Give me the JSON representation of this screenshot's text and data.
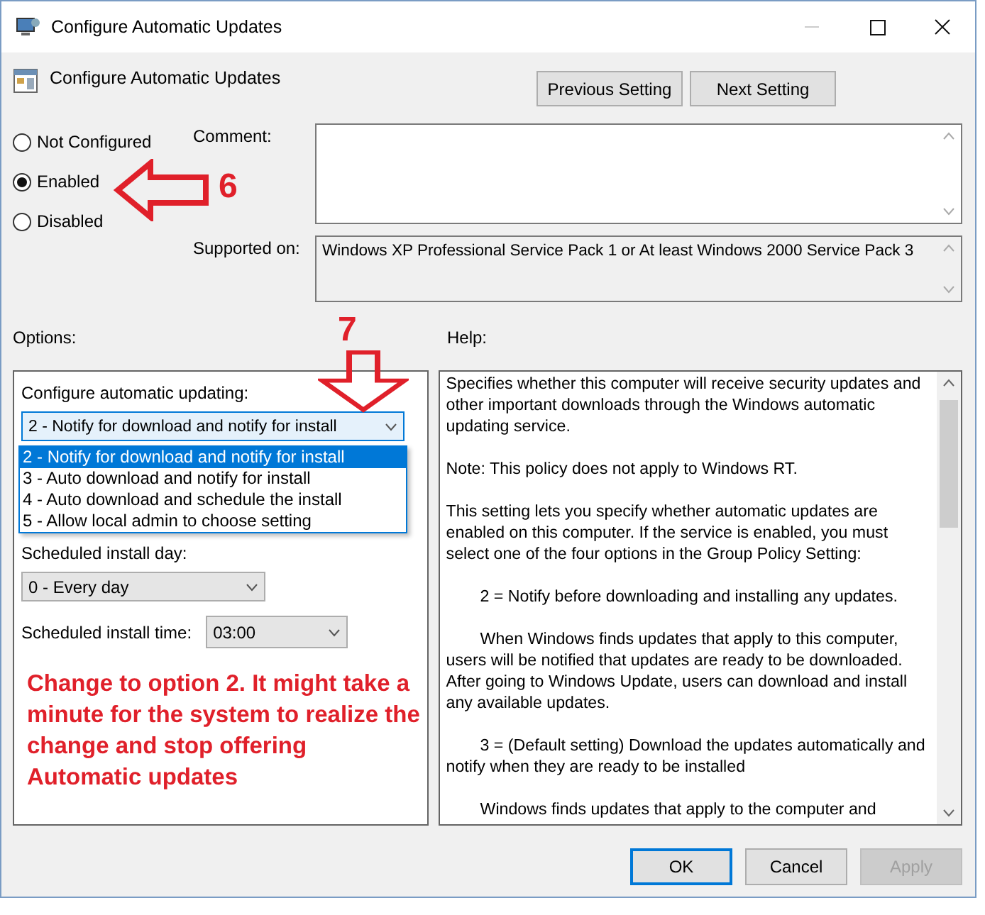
{
  "window": {
    "title": "Configure Automatic Updates"
  },
  "header": {
    "title": "Configure Automatic Updates"
  },
  "nav_buttons": [
    "Previous Setting",
    "Next Setting"
  ],
  "state_options": [
    {
      "label": "Not Configured",
      "selected": false
    },
    {
      "label": "Enabled",
      "selected": true
    },
    {
      "label": "Disabled",
      "selected": false
    }
  ],
  "comment": {
    "label": "Comment:"
  },
  "supported_on": {
    "label": "Supported on:",
    "value": "Windows XP Professional Service Pack 1 or At least Windows 2000 Service Pack 3"
  },
  "options": {
    "label": "Options:",
    "configure_label": "Configure automatic updating:",
    "configure_value": "2 - Notify for download and notify for install",
    "dropdown_items": [
      {
        "label": "2 - Notify for download and notify for install",
        "selected": true
      },
      {
        "label": "3 - Auto download and notify for install",
        "selected": false
      },
      {
        "label": "4 - Auto download and schedule the install",
        "selected": false
      },
      {
        "label": "5 - Allow local admin to choose setting",
        "selected": false
      }
    ],
    "install_day_label": "Scheduled install day:",
    "install_day_value": "0 - Every day",
    "install_time_label": "Scheduled install time:",
    "install_time_value": "03:00"
  },
  "help": {
    "label": "Help:",
    "paragraphs": [
      {
        "kind": "plain",
        "text": "Specifies whether this computer will receive security updates and other important downloads through the Windows automatic updating service."
      },
      {
        "kind": "plain",
        "text": "Note: This policy does not apply to Windows RT."
      },
      {
        "kind": "plain",
        "text": "This setting lets you specify whether automatic updates are enabled on this computer. If the service is enabled, you must select one of the four options in the Group Policy Setting:"
      },
      {
        "kind": "indented",
        "text": "2 = Notify before downloading and installing any updates."
      },
      {
        "kind": "indented",
        "text": "When Windows finds updates that apply to this computer, users will be notified that updates are ready to be downloaded. After going to Windows Update, users can download and install any available updates."
      },
      {
        "kind": "indented",
        "text": "3 = (Default setting) Download the updates automatically and notify when they are ready to be installed"
      },
      {
        "kind": "indented",
        "text": "Windows finds updates that apply to the computer and"
      }
    ]
  },
  "annotations": [
    {
      "kind": "arrow-left",
      "label": "6"
    },
    {
      "kind": "arrow-down",
      "label": "7"
    },
    {
      "kind": "note",
      "text": "Change to option 2. It might take a minute for the system to realize the change and stop offering Automatic updates"
    }
  ],
  "buttons": [
    {
      "label": "OK",
      "default": true,
      "disabled": false
    },
    {
      "label": "Cancel",
      "default": false,
      "disabled": false
    },
    {
      "label": "Apply",
      "default": false,
      "disabled": true
    }
  ]
}
